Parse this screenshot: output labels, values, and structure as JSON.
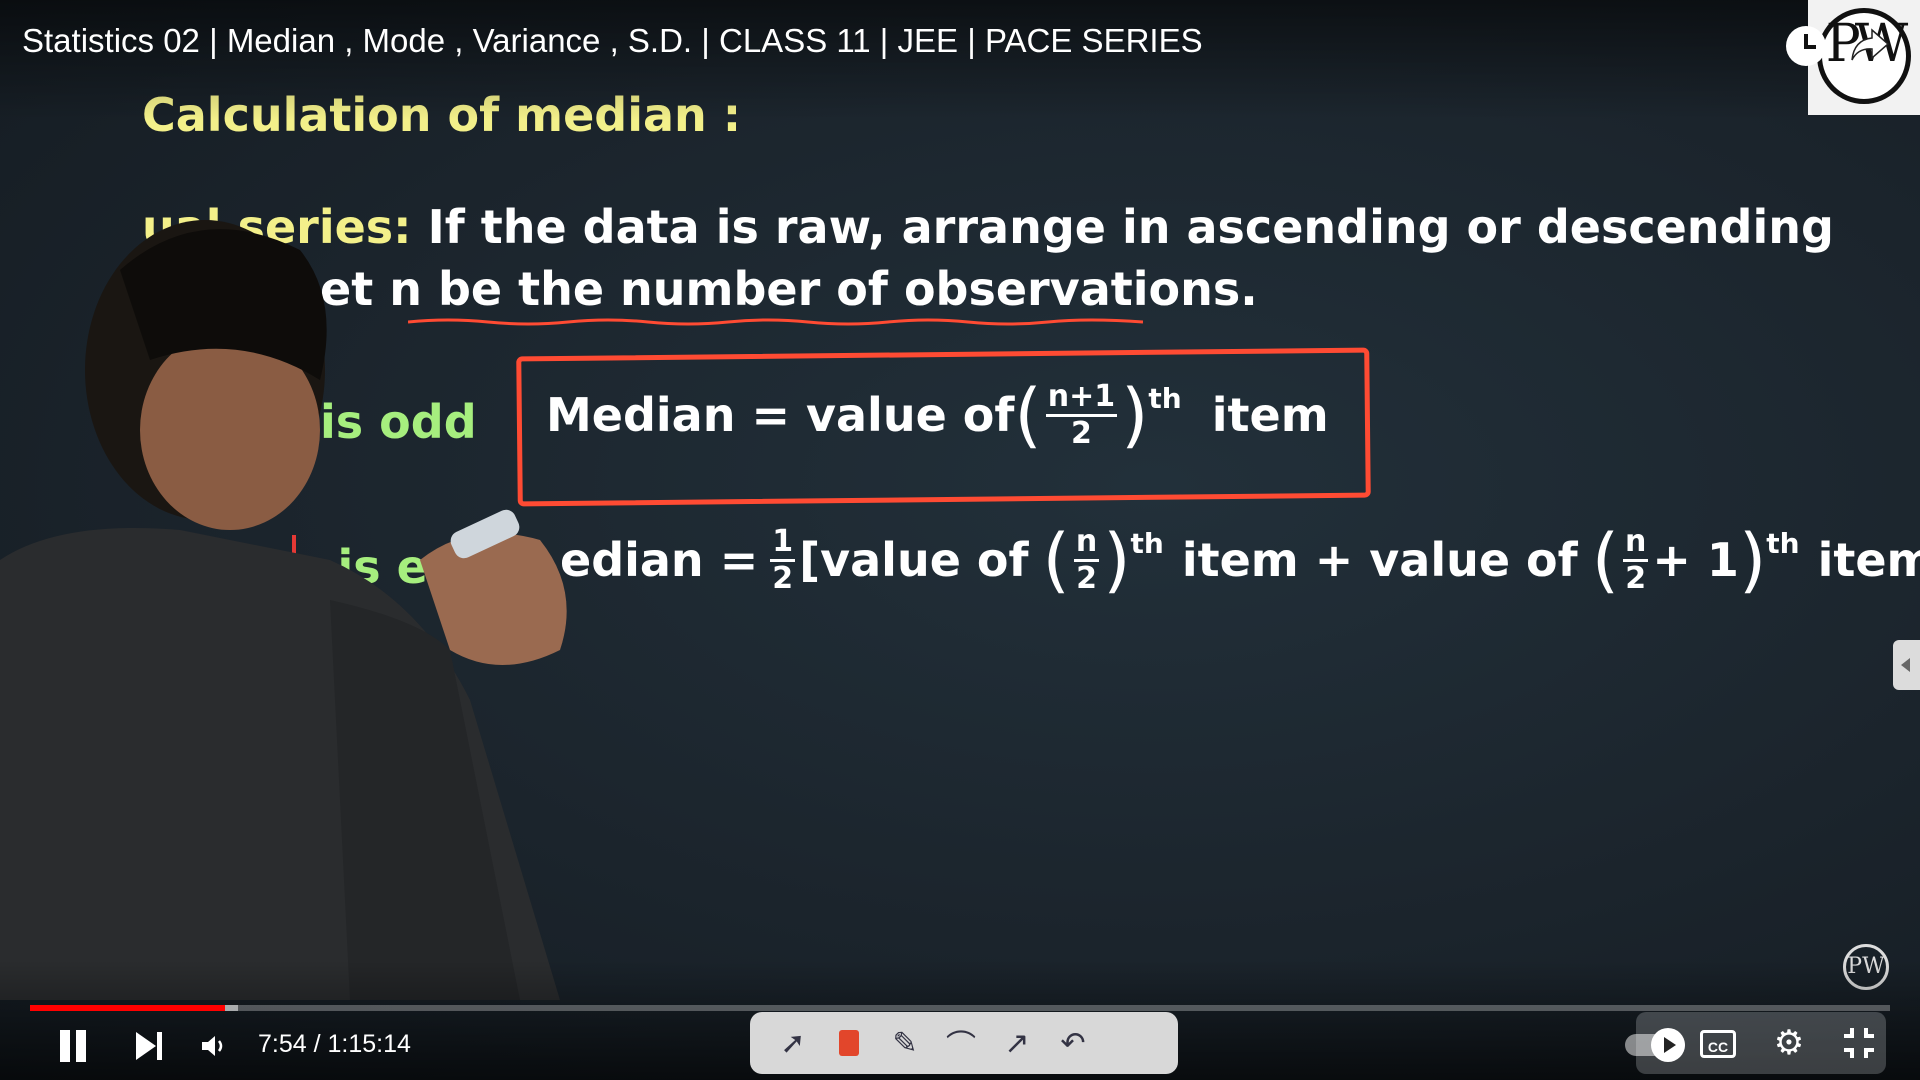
{
  "player": {
    "title": "Statistics 02 | Median , Mode , Variance , S.D. | CLASS 11 | JEE | PACE SERIES",
    "time_display": "7:54 / 1:15:14",
    "progress_fraction": 0.105,
    "buffer_fraction": 0.112,
    "accent_color": "#ff0000"
  },
  "board": {
    "heading": "Calculation of median :",
    "series_label": "ual series:",
    "line1_text": "If the data is raw, arrange in ascending or descending",
    "line2_text": "et n be the number of observations.",
    "odd_label": "is odd",
    "even_label": "r n is ev",
    "odd_formula": {
      "lhs": "Median = value of",
      "frac_num": "n+1",
      "frac_den": "2",
      "superscript": "th",
      "tail": "item"
    },
    "even_formula": {
      "lhs": "edian =",
      "half_num": "1",
      "half_den": "2",
      "part1": "[value of",
      "frac1_num": "n",
      "frac1_den": "2",
      "sup1": "th",
      "mid": "item + value of",
      "frac2_num": "n",
      "frac2_den": "2",
      "plus_one": "+ 1",
      "sup2": "th",
      "end": "item]."
    },
    "colors": {
      "heading": "#f3f08a",
      "green": "#a6ee7e",
      "red": "#ff4b33"
    }
  },
  "logo": {
    "text": "PW"
  },
  "toolbar": {
    "icons": [
      "pointer-icon",
      "eraser-icon",
      "pen-icon",
      "curve-icon",
      "arrow-icon",
      "undo-icon"
    ]
  },
  "controls": {
    "cc_label": "CC"
  }
}
